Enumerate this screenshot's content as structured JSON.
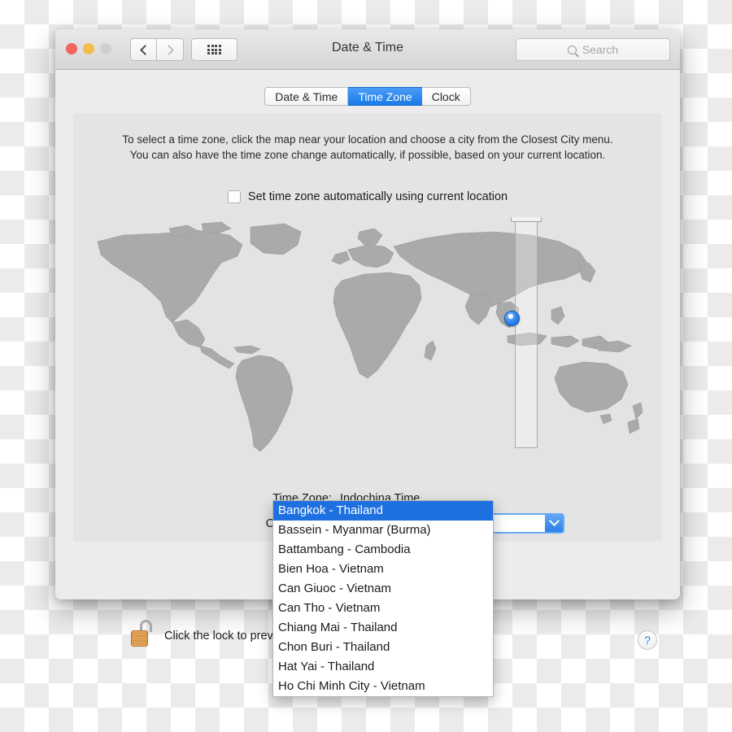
{
  "window": {
    "title": "Date & Time",
    "traffic_lights": [
      "close",
      "minimize",
      "zoom"
    ],
    "nav_back_icon": "chevron-left-icon",
    "nav_forward_icon": "chevron-right-icon",
    "show_all_icon": "grid-dots-icon"
  },
  "search": {
    "placeholder": "Search",
    "value": "",
    "icon": "search-icon"
  },
  "tabs": [
    {
      "label": "Date & Time",
      "active": false
    },
    {
      "label": "Time Zone",
      "active": true
    },
    {
      "label": "Clock",
      "active": false
    }
  ],
  "panel": {
    "instructions_line1": "To select a time zone, click the map near your location and choose a city from the Closest City menu.",
    "instructions_line2": "You can also have the time zone change automatically, if possible, based on your current location.",
    "auto_checkbox_label": "Set time zone automatically using current location",
    "auto_checkbox_checked": false
  },
  "map": {
    "pin_icon": "location-pin-icon",
    "band_label": "timezone-highlight-band",
    "top_marker_label": "timezone-top-marker"
  },
  "fields": {
    "time_zone_label": "Time Zone:",
    "time_zone_value": "Indochina Time",
    "closest_city_label": "Closest City:",
    "closest_city_value": "Bangkok - Thailand",
    "dropdown_arrow_icon": "chevron-down-icon"
  },
  "dropdown": {
    "selected_index": 0,
    "items": [
      "Bangkok - Thailand",
      "Bassein - Myanmar (Burma)",
      "Battambang - Cambodia",
      "Bien Hoa - Vietnam",
      "Can Giuoc - Vietnam",
      "Can Tho - Vietnam",
      "Chiang Mai - Thailand",
      "Chon Buri - Thailand",
      "Hat Yai - Thailand",
      "Ho Chi Minh City - Vietnam"
    ]
  },
  "footer": {
    "lock_icon": "unlocked-padlock-icon",
    "lock_text": "Click the lock to prevent further changes.",
    "help_label": "?"
  },
  "colors": {
    "accent_blue": "#1e70e0",
    "tab_active_blue": "#197ae8",
    "map_land": "#aaaaaa",
    "map_sea": "#e3e3e3",
    "window_bg": "#ececec",
    "panel_bg": "#e4e4e4"
  }
}
